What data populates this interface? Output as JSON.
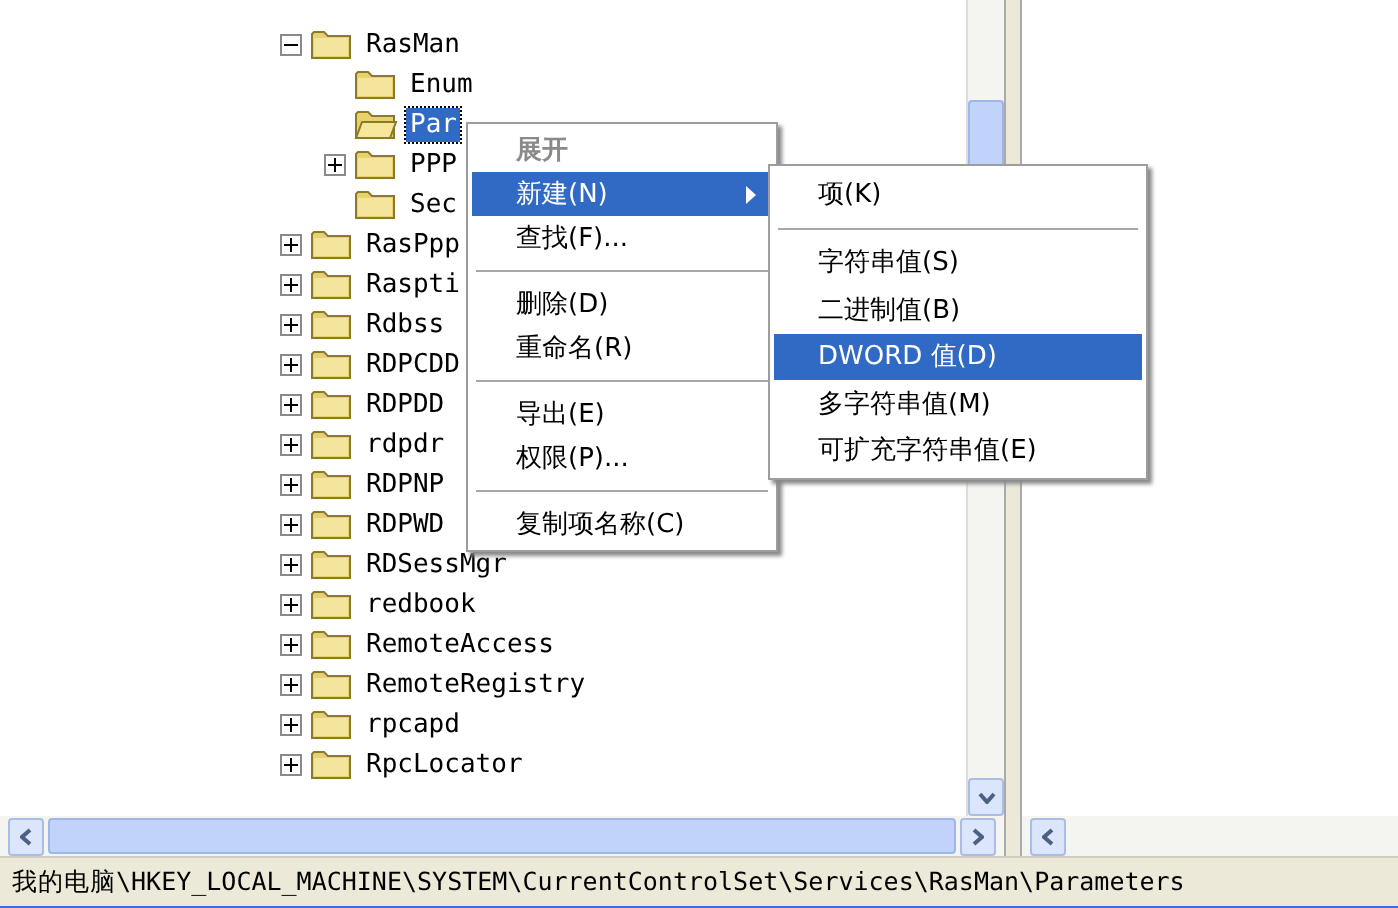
{
  "tree": [
    {
      "kind": "branch",
      "label": "RasMan",
      "selected": false,
      "expanded": true,
      "children": [
        {
          "kind": "leaf",
          "label": "Enum",
          "selected": false
        },
        {
          "kind": "leaf",
          "label": "Par",
          "selected": true
        },
        {
          "kind": "branch",
          "label": "PPP",
          "selected": false,
          "expanded": false
        },
        {
          "kind": "leaf",
          "label": "Sec",
          "selected": false
        }
      ]
    },
    {
      "kind": "branch",
      "label": "RasPpp",
      "selected": false,
      "expanded": false
    },
    {
      "kind": "branch",
      "label": "Raspti",
      "selected": false,
      "expanded": false
    },
    {
      "kind": "branch",
      "label": "Rdbss",
      "selected": false,
      "expanded": false
    },
    {
      "kind": "branch",
      "label": "RDPCDD",
      "selected": false,
      "expanded": false
    },
    {
      "kind": "branch",
      "label": "RDPDD",
      "selected": false,
      "expanded": false
    },
    {
      "kind": "branch",
      "label": "rdpdr",
      "selected": false,
      "expanded": false
    },
    {
      "kind": "branch",
      "label": "RDPNP",
      "selected": false,
      "expanded": false
    },
    {
      "kind": "branch",
      "label": "RDPWD",
      "selected": false,
      "expanded": false
    },
    {
      "kind": "branch",
      "label": "RDSessMgr",
      "selected": false,
      "expanded": false
    },
    {
      "kind": "branch",
      "label": "redbook",
      "selected": false,
      "expanded": false
    },
    {
      "kind": "branch",
      "label": "RemoteAccess",
      "selected": false,
      "expanded": false
    },
    {
      "kind": "branch",
      "label": "RemoteRegistry",
      "selected": false,
      "expanded": false
    },
    {
      "kind": "branch",
      "label": "rpcapd",
      "selected": false,
      "expanded": false
    },
    {
      "kind": "branch",
      "label": "RpcLocator",
      "selected": false,
      "expanded": false
    }
  ],
  "context_menu": {
    "items": [
      {
        "kind": "item",
        "label": "展开",
        "selected": false,
        "disabled": true,
        "submenu": false
      },
      {
        "kind": "item",
        "label": "新建(N)",
        "selected": true,
        "disabled": false,
        "submenu": true
      },
      {
        "kind": "item",
        "label": "查找(F)...",
        "selected": false,
        "disabled": false,
        "submenu": false
      },
      {
        "kind": "separator"
      },
      {
        "kind": "item",
        "label": "删除(D)",
        "selected": false,
        "disabled": false,
        "submenu": false
      },
      {
        "kind": "item",
        "label": "重命名(R)",
        "selected": false,
        "disabled": false,
        "submenu": false
      },
      {
        "kind": "separator"
      },
      {
        "kind": "item",
        "label": "导出(E)",
        "selected": false,
        "disabled": false,
        "submenu": false
      },
      {
        "kind": "item",
        "label": "权限(P)...",
        "selected": false,
        "disabled": false,
        "submenu": false
      },
      {
        "kind": "separator"
      },
      {
        "kind": "item",
        "label": "复制项名称(C)",
        "selected": false,
        "disabled": false,
        "submenu": false
      }
    ]
  },
  "submenu": {
    "items": [
      {
        "kind": "item",
        "label": "项(K)",
        "selected": false,
        "disabled": false,
        "submenu": false
      },
      {
        "kind": "separator"
      },
      {
        "kind": "item",
        "label": "字符串值(S)",
        "selected": false,
        "disabled": false,
        "submenu": false
      },
      {
        "kind": "item",
        "label": "二进制值(B)",
        "selected": false,
        "disabled": false,
        "submenu": false
      },
      {
        "kind": "item",
        "label": "DWORD 值(D)",
        "selected": true,
        "disabled": false,
        "submenu": false
      },
      {
        "kind": "item",
        "label": "多字符串值(M)",
        "selected": false,
        "disabled": false,
        "submenu": false
      },
      {
        "kind": "item",
        "label": "可扩充字符串值(E)",
        "selected": false,
        "disabled": false,
        "submenu": false
      }
    ]
  },
  "status_bar": {
    "path": "我的电脑\\HKEY_LOCAL_MACHINE\\SYSTEM\\CurrentControlSet\\Services\\RasMan\\Parameters"
  }
}
